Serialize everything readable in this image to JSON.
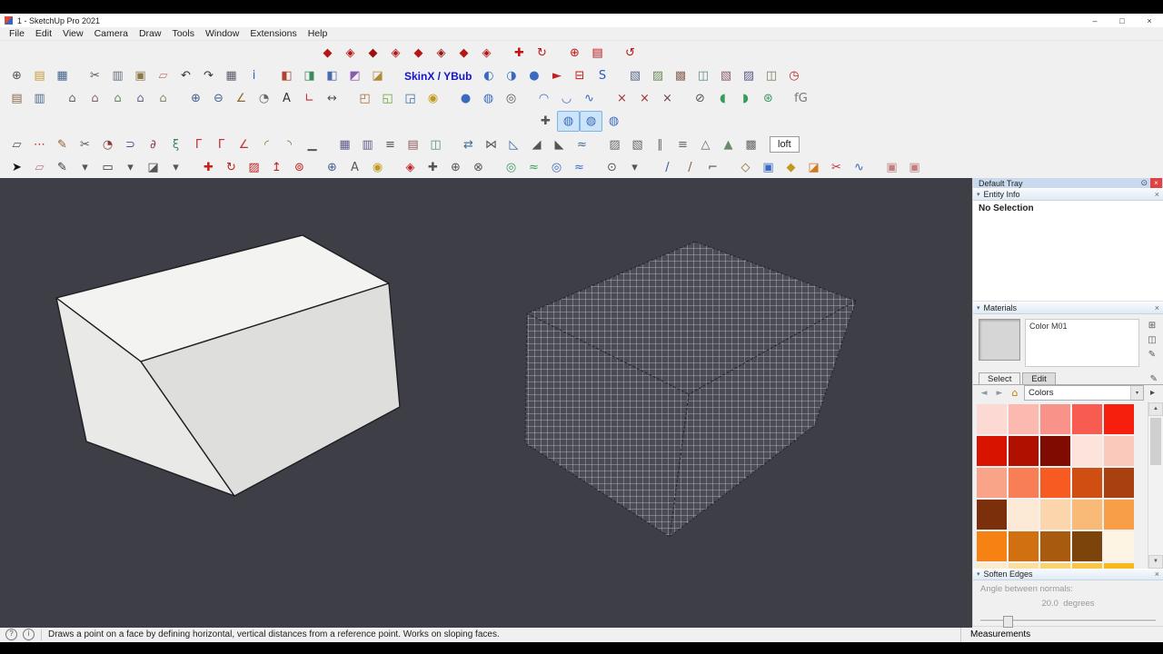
{
  "titlebar": {
    "title": "1 - SketchUp Pro 2021",
    "minimize": "–",
    "maximize": "□",
    "close": "×"
  },
  "menubar": {
    "items": [
      {
        "n": "menu-file",
        "label": "File"
      },
      {
        "n": "menu-edit",
        "label": "Edit"
      },
      {
        "n": "menu-view",
        "label": "View"
      },
      {
        "n": "menu-camera",
        "label": "Camera"
      },
      {
        "n": "menu-draw",
        "label": "Draw"
      },
      {
        "n": "menu-tools",
        "label": "Tools"
      },
      {
        "n": "menu-window",
        "label": "Window"
      },
      {
        "n": "menu-extensions",
        "label": "Extensions"
      },
      {
        "n": "menu-help",
        "label": "Help"
      }
    ]
  },
  "toolbars": {
    "skinx_label": "SkinX / YBub",
    "loft_label": "loft",
    "rowA": [
      {
        "n": "fredoscale-icon-1",
        "g": "◆",
        "c": "#b51616"
      },
      {
        "n": "fredoscale-icon-2",
        "g": "◈",
        "c": "#b51616"
      },
      {
        "n": "fredoscale-icon-3",
        "g": "◆",
        "c": "#9a1010"
      },
      {
        "n": "fredoscale-icon-4",
        "g": "◈",
        "c": "#b51616"
      },
      {
        "n": "fredoscale-icon-5",
        "g": "◆",
        "c": "#b51616"
      },
      {
        "n": "fredoscale-icon-6",
        "g": "◈",
        "c": "#9a1010"
      },
      {
        "n": "fredoscale-icon-7",
        "g": "◆",
        "c": "#b51616"
      },
      {
        "n": "fredoscale-icon-8",
        "g": "◈",
        "c": "#b51616"
      },
      {
        "gap": true
      },
      {
        "n": "move-points-icon",
        "g": "✚",
        "c": "#c01414"
      },
      {
        "n": "rotate-plugin-icon",
        "g": "↻",
        "c": "#c01414"
      },
      {
        "gap": true
      },
      {
        "n": "globe-plugin-icon",
        "g": "⊕",
        "c": "#c01414"
      },
      {
        "n": "sheet-plugin-icon",
        "g": "▤",
        "c": "#c01414"
      },
      {
        "gap": true
      },
      {
        "n": "refresh-plugin-icon",
        "g": "↺",
        "c": "#c01414"
      }
    ],
    "rowB1": [
      {
        "n": "new-icon",
        "g": "⊕",
        "c": "#555555"
      },
      {
        "n": "open-icon",
        "g": "▤",
        "c": "#c79a36"
      },
      {
        "n": "save-icon",
        "g": "▦",
        "c": "#44618f"
      },
      {
        "gap": true
      },
      {
        "n": "cut-icon",
        "g": "✂",
        "c": "#555555"
      },
      {
        "n": "copy-icon",
        "g": "▥",
        "c": "#66707e"
      },
      {
        "n": "paste-icon",
        "g": "▣",
        "c": "#8a7a4a"
      },
      {
        "n": "erase-icon",
        "g": "▱",
        "c": "#c07878"
      },
      {
        "n": "undo-icon",
        "g": "↶",
        "c": "#333333"
      },
      {
        "n": "redo-icon",
        "g": "↷",
        "c": "#333333"
      },
      {
        "n": "print-icon",
        "g": "▦",
        "c": "#5a5a68"
      },
      {
        "n": "model-info-icon",
        "g": "i",
        "c": "#2565c0"
      },
      {
        "gap": true
      },
      {
        "n": "style-box-icon-1",
        "g": "◧",
        "c": "#b04030"
      },
      {
        "n": "style-box-icon-2",
        "g": "◨",
        "c": "#3a8a5a"
      },
      {
        "n": "style-box-icon-3",
        "g": "◧",
        "c": "#4a6ab0"
      },
      {
        "n": "style-box-icon-4",
        "g": "◩",
        "c": "#8a5ab0"
      },
      {
        "n": "style-box-icon-5",
        "g": "◪",
        "c": "#b08a3a"
      },
      {
        "gap": true
      }
    ],
    "rowB2": [
      {
        "n": "skinx-sphere-icon-1",
        "g": "◐",
        "c": "#3a6ac0"
      },
      {
        "n": "skinx-sphere-icon-2",
        "g": "◑",
        "c": "#3a6ac0"
      },
      {
        "n": "skinx-sphere-icon-3",
        "g": "●",
        "c": "#3a6ac0"
      },
      {
        "n": "play-icon",
        "g": "►",
        "c": "#c02020"
      },
      {
        "n": "minus-box-icon",
        "g": "⊟",
        "c": "#c02020"
      },
      {
        "n": "speed-icon",
        "g": "S",
        "c": "#2a5ac0"
      },
      {
        "gap": true
      },
      {
        "n": "solid-tools-icon-1",
        "g": "▧",
        "c": "#5a6a8a"
      },
      {
        "n": "solid-tools-icon-2",
        "g": "▨",
        "c": "#6a8a5a"
      },
      {
        "n": "solid-tools-icon-3",
        "g": "▩",
        "c": "#8a6a5a"
      },
      {
        "n": "solid-tools-icon-4",
        "g": "◫",
        "c": "#5a8a8a"
      },
      {
        "n": "solid-tools-icon-5",
        "g": "▧",
        "c": "#8a5a6a"
      },
      {
        "n": "solid-tools-icon-6",
        "g": "▨",
        "c": "#5a5a8a"
      },
      {
        "n": "solid-tools-icon-7",
        "g": "◫",
        "c": "#7a7a5a"
      },
      {
        "n": "timer-icon",
        "g": "◷",
        "c": "#c02020"
      }
    ],
    "rowC": [
      {
        "n": "paste-in-place-icon",
        "g": "▤",
        "c": "#8a6a4a"
      },
      {
        "n": "layout-icon",
        "g": "▥",
        "c": "#4a6a8a"
      },
      {
        "gap": true
      },
      {
        "n": "iso-view-icon",
        "g": "⌂",
        "c": "#666666"
      },
      {
        "n": "top-view-icon",
        "g": "⌂",
        "c": "#8a6666"
      },
      {
        "n": "front-view-icon",
        "g": "⌂",
        "c": "#668a66"
      },
      {
        "n": "right-view-icon",
        "g": "⌂",
        "c": "#66668a"
      },
      {
        "n": "back-view-icon",
        "g": "⌂",
        "c": "#8a8a66"
      },
      {
        "gap": true
      },
      {
        "n": "zoom-in-icon",
        "g": "⊕",
        "c": "#44618f"
      },
      {
        "n": "zoom-out-icon",
        "g": "⊖",
        "c": "#44618f"
      },
      {
        "n": "tape-measure-icon",
        "g": "∠",
        "c": "#8a6a2a"
      },
      {
        "n": "protractor-icon",
        "g": "◔",
        "c": "#666666"
      },
      {
        "n": "text-tool-icon",
        "g": "A",
        "c": "#333333"
      },
      {
        "n": "axes-icon",
        "g": "∟",
        "c": "#c03030"
      },
      {
        "n": "dimension-icon",
        "g": "↔",
        "c": "#555555"
      },
      {
        "gap": true
      },
      {
        "n": "section-box-icon-1",
        "g": "◰",
        "c": "#a06a3a"
      },
      {
        "n": "section-box-icon-2",
        "g": "◱",
        "c": "#6aa03a"
      },
      {
        "n": "section-box-icon-3",
        "g": "◲",
        "c": "#3a6aa0"
      },
      {
        "n": "paint-bucket-icon",
        "g": "◉",
        "c": "#c09a20"
      },
      {
        "gap": true
      },
      {
        "n": "sphere-blue-icon-1",
        "g": "●",
        "c": "#3a6ac0"
      },
      {
        "n": "sphere-blue-icon-2",
        "g": "◍",
        "c": "#3a6ac0"
      },
      {
        "n": "eye-icon",
        "g": "◎",
        "c": "#555555"
      },
      {
        "gap": true
      },
      {
        "n": "arc-up-icon",
        "g": "◠",
        "c": "#3a6ac0"
      },
      {
        "n": "arc-down-icon",
        "g": "◡",
        "c": "#3a6ac0"
      },
      {
        "n": "wave-icon",
        "g": "∿",
        "c": "#3a6ac0"
      },
      {
        "gap": true
      },
      {
        "n": "cross-red-icon-1",
        "g": "×",
        "c": "#a03030"
      },
      {
        "n": "cross-red-icon-2",
        "g": "×",
        "c": "#a03030"
      },
      {
        "n": "cross-red-icon-3",
        "g": "×",
        "c": "#704040"
      },
      {
        "gap": true
      },
      {
        "n": "circle-slash-icon",
        "g": "⊘",
        "c": "#555555"
      },
      {
        "n": "leaf-icon-1",
        "g": "◖",
        "c": "#3a9a5a"
      },
      {
        "n": "leaf-icon-2",
        "g": "◗",
        "c": "#3a9a5a"
      },
      {
        "n": "flower-icon",
        "g": "⊛",
        "c": "#3a9a5a"
      },
      {
        "gap": true
      },
      {
        "n": "font-tool-icon",
        "g": "fG",
        "c": "#777777"
      }
    ],
    "rowD": [
      {
        "n": "pan-cross-icon",
        "g": "✚",
        "c": "#555555"
      },
      {
        "n": "quadface-icon-1",
        "g": "◍",
        "c": "#3a6ac0",
        "sel": true
      },
      {
        "n": "quadface-icon-2",
        "g": "◍",
        "c": "#3a6ac0",
        "sel": true
      },
      {
        "n": "quadface-icon-3",
        "g": "◍",
        "c": "#3a6ac0"
      }
    ],
    "rowE": [
      {
        "n": "bezier-icon",
        "g": "▱",
        "c": "#555555"
      },
      {
        "n": "dots-icon",
        "g": "⋯",
        "c": "#c03030"
      },
      {
        "n": "freehand-icon",
        "g": "✎",
        "c": "#8a5a2a"
      },
      {
        "n": "divide-icon",
        "g": "✂",
        "c": "#555555"
      },
      {
        "n": "pie-icon",
        "g": "◔",
        "c": "#8a3a3a"
      },
      {
        "n": "hook-icon",
        "g": "⊃",
        "c": "#3a5a8a"
      },
      {
        "n": "curl-icon",
        "g": "∂",
        "c": "#8a3a5a"
      },
      {
        "n": "spring-icon",
        "g": "ξ",
        "c": "#3a8a5a"
      },
      {
        "n": "corner-icon-1",
        "g": "Γ",
        "c": "#c03030"
      },
      {
        "n": "corner-icon-2",
        "g": "Γ",
        "c": "#c03030"
      },
      {
        "n": "angle-icon",
        "g": "∠",
        "c": "#c03030"
      },
      {
        "n": "fillet-icon-1",
        "g": "◜",
        "c": "#8a6a2a"
      },
      {
        "n": "fillet-icon-2",
        "g": "◝",
        "c": "#8a6a2a"
      },
      {
        "n": "flatten-icon",
        "g": "▁",
        "c": "#555555"
      },
      {
        "gap": true
      },
      {
        "n": "grid-icon-1",
        "g": "▦",
        "c": "#5a5a8a"
      },
      {
        "n": "grid-icon-2",
        "g": "▥",
        "c": "#5a5a8a"
      },
      {
        "n": "steps-icon",
        "g": "≡",
        "c": "#555555"
      },
      {
        "n": "wall-icon",
        "g": "▤",
        "c": "#8a5a5a"
      },
      {
        "n": "panel-icon",
        "g": "◫",
        "c": "#5a8a8a"
      },
      {
        "gap": true
      },
      {
        "n": "swap-icon",
        "g": "⇄",
        "c": "#3a6a9a"
      },
      {
        "n": "mirror-icon",
        "g": "⋈",
        "c": "#555555"
      },
      {
        "n": "wedge-icon",
        "g": "◺",
        "c": "#3a6a9a"
      },
      {
        "n": "ramp-icon",
        "g": "◢",
        "c": "#555555"
      },
      {
        "n": "hill-icon",
        "g": "◣",
        "c": "#555555"
      },
      {
        "n": "waves-icon",
        "g": "≈",
        "c": "#3a6a9a"
      },
      {
        "gap": true
      },
      {
        "n": "hatch-icon-1",
        "g": "▨",
        "c": "#666666"
      },
      {
        "n": "hatch-icon-2",
        "g": "▧",
        "c": "#666666"
      },
      {
        "n": "parallel-icon",
        "g": "∥",
        "c": "#666666"
      },
      {
        "n": "fence-icon",
        "g": "≡",
        "c": "#666666"
      },
      {
        "n": "mountain-icon",
        "g": "△",
        "c": "#666666"
      },
      {
        "n": "terrain-icon",
        "g": "▲",
        "c": "#6a8a6a"
      },
      {
        "n": "weave-icon",
        "g": "▩",
        "c": "#666666"
      }
    ],
    "rowF": [
      {
        "n": "select-tool-icon",
        "g": "➤",
        "c": "#111111"
      },
      {
        "n": "eraser-tool-icon",
        "g": "▱",
        "c": "#c07890"
      },
      {
        "n": "line-tool-icon",
        "g": "✎",
        "c": "#333333"
      },
      {
        "n": "line-dropdown-icon",
        "g": "▾",
        "c": "#555555"
      },
      {
        "n": "shape-tool-icon",
        "g": "▭",
        "c": "#333333"
      },
      {
        "n": "shape-dropdown-icon",
        "g": "▾",
        "c": "#555555"
      },
      {
        "n": "fill-tool-icon",
        "g": "◪",
        "c": "#555555"
      },
      {
        "n": "fill-dropdown-icon",
        "g": "▾",
        "c": "#555555"
      },
      {
        "gap": true
      },
      {
        "n": "move-tool-icon",
        "g": "✚",
        "c": "#c02020"
      },
      {
        "n": "rotate-tool-icon",
        "g": "↻",
        "c": "#c02020"
      },
      {
        "n": "scale-tool-icon",
        "g": "▨",
        "c": "#c02020"
      },
      {
        "n": "pushpull-tool-icon",
        "g": "↥",
        "c": "#c02020"
      },
      {
        "n": "offset-tool-icon",
        "g": "⊚",
        "c": "#c02020"
      },
      {
        "gap": true
      },
      {
        "n": "zoom-tool-icon",
        "g": "⊕",
        "c": "#44618f"
      },
      {
        "n": "label-tool-icon",
        "g": "A",
        "c": "#555555"
      },
      {
        "n": "bucket-tool-icon",
        "g": "◉",
        "c": "#c09a20"
      },
      {
        "gap": true
      },
      {
        "n": "orbit-tool-icon",
        "g": "◈",
        "c": "#c02020"
      },
      {
        "n": "pan-tool-icon",
        "g": "✚",
        "c": "#555555"
      },
      {
        "n": "zoom-window-icon",
        "g": "⊕",
        "c": "#555555"
      },
      {
        "n": "zoom-extents-icon",
        "g": "⊗",
        "c": "#555555"
      },
      {
        "gap": true
      },
      {
        "n": "sandbox-icon-1",
        "g": "◎",
        "c": "#3a9a5a"
      },
      {
        "n": "sandbox-icon-2",
        "g": "≈",
        "c": "#3a9a5a"
      },
      {
        "n": "sandbox-icon-3",
        "g": "◎",
        "c": "#3a6ac0"
      },
      {
        "n": "sandbox-icon-4",
        "g": "≈",
        "c": "#3a6ac0"
      },
      {
        "gap": true
      },
      {
        "n": "person-tool-icon",
        "g": "⊙",
        "c": "#555555"
      },
      {
        "n": "person-dropdown-icon",
        "g": "▾",
        "c": "#555555"
      },
      {
        "gap": true
      },
      {
        "n": "pencil-line-icon-1",
        "g": "/",
        "c": "#3a5a8a"
      },
      {
        "n": "pencil-line-icon-2",
        "g": "/",
        "c": "#8a5a3a"
      },
      {
        "n": "hook2-icon",
        "g": "⌐",
        "c": "#555555"
      },
      {
        "gap": true
      },
      {
        "n": "chisel-icon",
        "g": "◇",
        "c": "#8a6a2a"
      },
      {
        "n": "box-blue-icon",
        "g": "▣",
        "c": "#3a6ac0"
      },
      {
        "n": "gem-icon",
        "g": "◆",
        "c": "#c09a20"
      },
      {
        "n": "ramp-orange-icon",
        "g": "◪",
        "c": "#d07820"
      },
      {
        "n": "cut2-icon",
        "g": "✂",
        "c": "#c03030"
      },
      {
        "n": "scurve-icon",
        "g": "∿",
        "c": "#3a6ac0"
      },
      {
        "gap": true
      },
      {
        "n": "pink-panel-icon-1",
        "g": "▣",
        "c": "#c08080"
      },
      {
        "n": "pink-panel-icon-2",
        "g": "▣",
        "c": "#c08080"
      }
    ]
  },
  "tray": {
    "title": "Default Tray",
    "icons": {
      "pin": "⊙",
      "close": "×",
      "tri": "▾",
      "back": "◄",
      "fwd": "►",
      "home": "⌂",
      "caret": "▾",
      "detail": "▸",
      "up": "▲",
      "down": "▼",
      "newmat": "⊞",
      "pane": "◫",
      "dropper": "✎"
    },
    "entity_info": {
      "title": "Entity Info",
      "status": "No Selection"
    },
    "materials": {
      "title": "Materials",
      "name": "Color M01",
      "tab_select": "Select",
      "tab_edit": "Edit",
      "dropdown": "Colors"
    },
    "swatches": [
      {
        "n": "color-swatch",
        "hex": "#fcd9d3"
      },
      {
        "n": "color-swatch",
        "hex": "#fbb9b0"
      },
      {
        "n": "color-swatch",
        "hex": "#f99288"
      },
      {
        "n": "color-swatch",
        "hex": "#f85c50"
      },
      {
        "n": "color-swatch",
        "hex": "#f61e0c"
      },
      {
        "n": "color-swatch",
        "hex": "#d81400"
      },
      {
        "n": "color-swatch",
        "hex": "#b01000"
      },
      {
        "n": "color-swatch",
        "hex": "#800b00"
      },
      {
        "n": "color-swatch",
        "hex": "#fce4dc"
      },
      {
        "n": "color-swatch",
        "hex": "#fac9bc"
      },
      {
        "n": "color-swatch",
        "hex": "#f9a488"
      },
      {
        "n": "color-swatch",
        "hex": "#f87e55"
      },
      {
        "n": "color-swatch",
        "hex": "#f75b22"
      },
      {
        "n": "color-swatch",
        "hex": "#d14e12"
      },
      {
        "n": "color-swatch",
        "hex": "#a84010"
      },
      {
        "n": "color-swatch",
        "hex": "#7c2f0b"
      },
      {
        "n": "color-swatch",
        "hex": "#fcead6"
      },
      {
        "n": "color-swatch",
        "hex": "#fbd5ab"
      },
      {
        "n": "color-swatch",
        "hex": "#f9ba78"
      },
      {
        "n": "color-swatch",
        "hex": "#f79e46"
      },
      {
        "n": "color-swatch",
        "hex": "#f68213"
      },
      {
        "n": "color-swatch",
        "hex": "#d07011"
      },
      {
        "n": "color-swatch",
        "hex": "#a85b0e"
      },
      {
        "n": "color-swatch",
        "hex": "#7c430a"
      },
      {
        "n": "color-swatch",
        "hex": "#fdf4e3"
      },
      {
        "n": "color-swatch",
        "hex": "#fdeccb"
      },
      {
        "n": "color-swatch",
        "hex": "#fbdf9e"
      },
      {
        "n": "color-swatch",
        "hex": "#f9d272"
      },
      {
        "n": "color-swatch",
        "hex": "#f8c546"
      },
      {
        "n": "color-swatch",
        "hex": "#f6b81a"
      }
    ],
    "soften": {
      "title": "Soften Edges",
      "label": "Angle between normals:",
      "value": "20.0",
      "unit": "degrees"
    }
  },
  "statusbar": {
    "q": "?",
    "i": "i",
    "help": "Draws a point on a face by defining horizontal, vertical distances from a reference point. Works on sloping faces.",
    "measurements": "Measurements"
  }
}
